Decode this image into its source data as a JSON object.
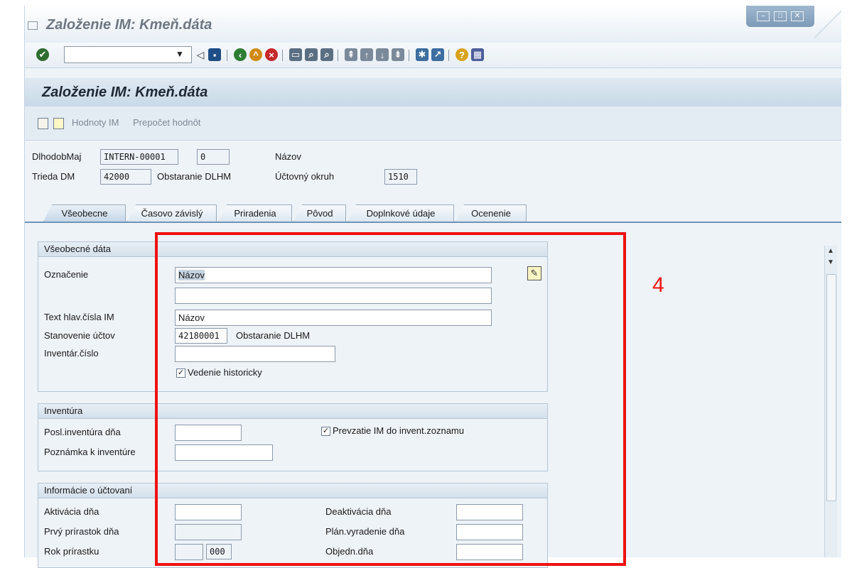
{
  "window": {
    "title": "Založenie IM: Kmeň.dáta"
  },
  "toolbar": {
    "command_value": ""
  },
  "screen": {
    "title": "Založenie IM: Kmeň.dáta",
    "app_buttons": [
      "Hodnoty IM",
      "Prepočet hodnôt"
    ]
  },
  "header": {
    "asset_label": "DlhodobMaj",
    "asset_number": "INTERN-00001",
    "sub_number": "0",
    "description_label": "Názov",
    "class_label": "Trieda DM",
    "class_value": "42000",
    "class_text": "Obstaranie DLHM",
    "company_label": "Účtovný okruh",
    "company_value": "1510"
  },
  "tabs": [
    "Všeobecne",
    "Časovo závislý",
    "Priradenia",
    "Pôvod",
    "Doplnkové údaje",
    "Ocenenie"
  ],
  "general": {
    "title": "Všeobecné dáta",
    "designation_label": "Označenie",
    "designation_value": "Názov",
    "designation2_value": "",
    "main_text_label": "Text hlav.čísla IM",
    "main_text_value": "Názov",
    "account_label": "Stanovenie účtov",
    "account_value": "42180001",
    "account_text": "Obstaranie DLHM",
    "inventory_no_label": "Inventár.číslo",
    "inventory_no_value": "",
    "history_label": "Vedenie historicky"
  },
  "inventory": {
    "title": "Inventúra",
    "last_inv_label": "Posl.inventúra dňa",
    "last_inv_value": "",
    "note_label": "Poznámka k inventúre",
    "note_value": "",
    "include_label": "Prevzatie IM do invent.zoznamu"
  },
  "posting": {
    "title": "Informácie o účtovaní",
    "capitalized_label": "Aktivácia dňa",
    "deactivation_label": "Deaktivácia dňa",
    "first_acq_label": "Prvý prírastok dňa",
    "planned_retire_label": "Plán.vyradenie dňa",
    "acq_year_label": "Rok prírastku",
    "acq_period_value": "000",
    "ordered_label": "Objedn.dňa"
  },
  "annotation": {
    "step_number": "4",
    "color": "#ef1111"
  }
}
